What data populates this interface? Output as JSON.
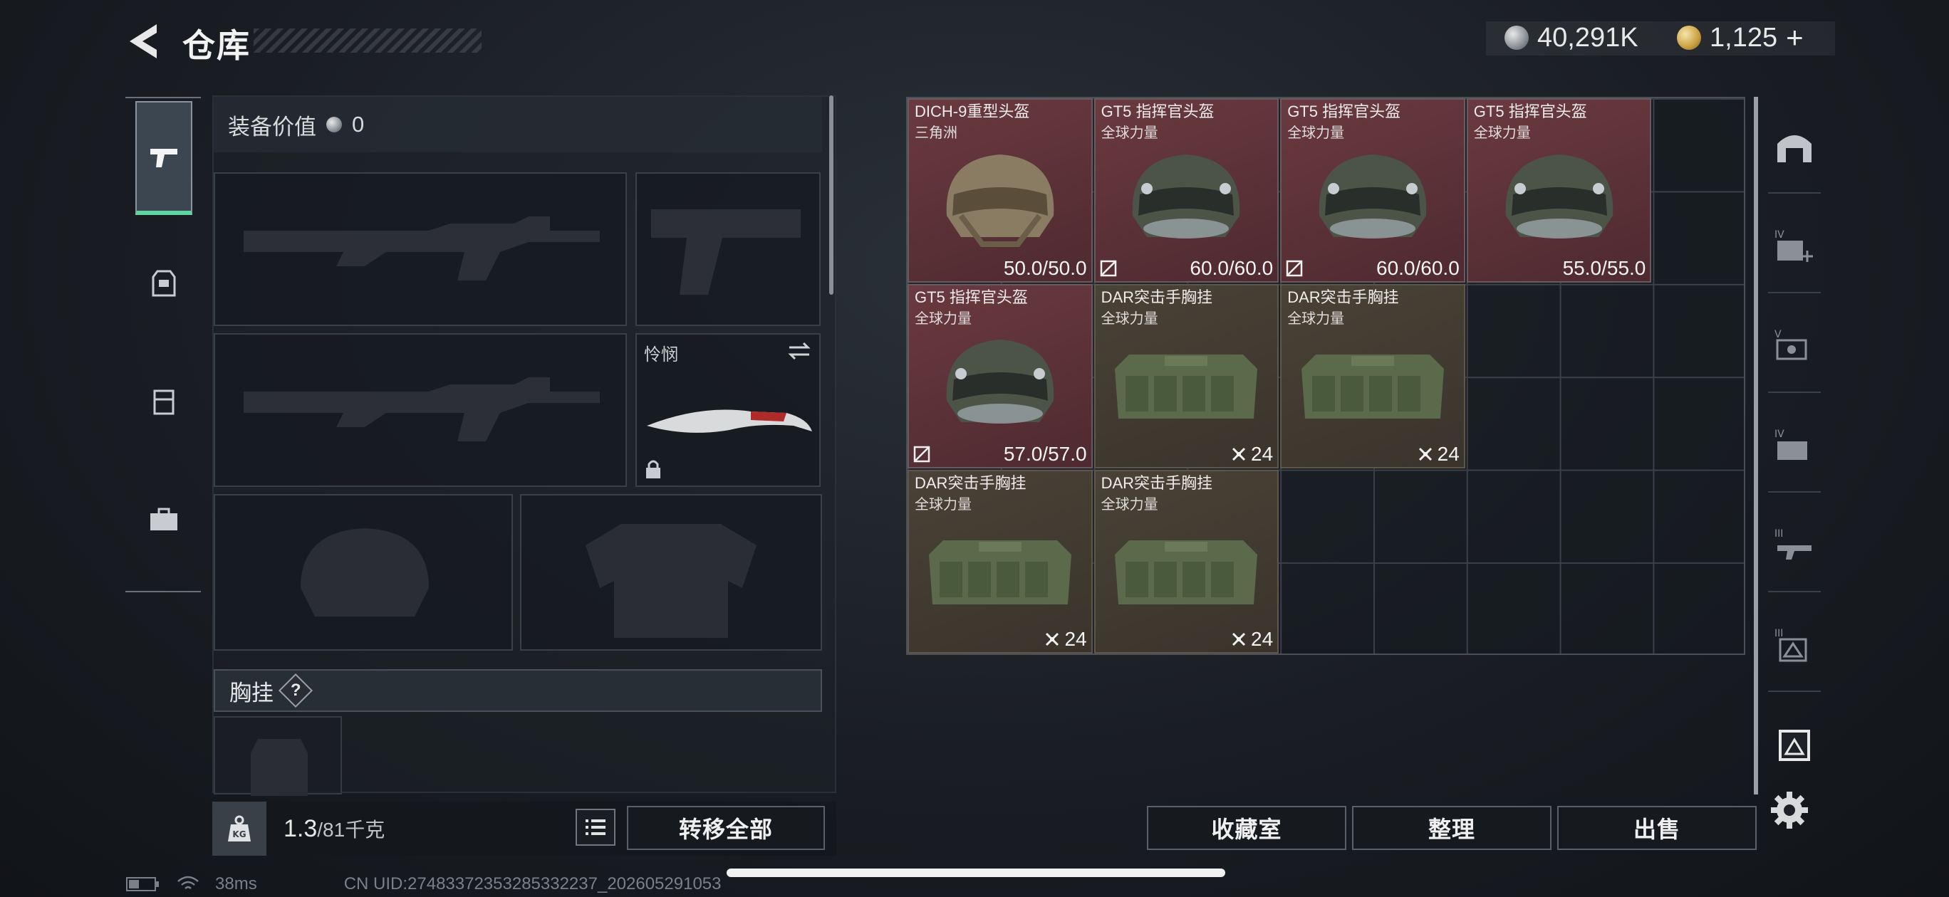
{
  "header": {
    "title": "仓库",
    "currency_a": "40,291K",
    "currency_b": "1,125",
    "add": "+"
  },
  "equipment": {
    "value_label": "装备价值",
    "value": "0",
    "melee_label": "怜悯",
    "chest_label": "胸挂",
    "help": "?",
    "weight_current": "1.3",
    "weight_max": "/81千克",
    "kg": "KG",
    "transfer_all": "转移全部"
  },
  "inventory": {
    "items": [
      {
        "name": "DICH-9重型头盔",
        "sub": "三角洲",
        "value": "50.0/50.0",
        "kind": "helmet-tan",
        "broken": false
      },
      {
        "name": "GT5 指挥官头盔",
        "sub": "全球力量",
        "value": "60.0/60.0",
        "kind": "helmet",
        "broken": true
      },
      {
        "name": "GT5 指挥官头盔",
        "sub": "全球力量",
        "value": "60.0/60.0",
        "kind": "helmet",
        "broken": true
      },
      {
        "name": "GT5 指挥官头盔",
        "sub": "全球力量",
        "value": "55.0/55.0",
        "kind": "helmet",
        "broken": false
      },
      {
        "name": "GT5 指挥官头盔",
        "sub": "全球力量",
        "value": "57.0/57.0",
        "kind": "helmet",
        "broken": true
      },
      {
        "name": "DAR突击手胸挂",
        "sub": "全球力量",
        "value": "24",
        "kind": "rig",
        "broken": false
      },
      {
        "name": "DAR突击手胸挂",
        "sub": "全球力量",
        "value": "24",
        "kind": "rig",
        "broken": false
      },
      {
        "name": "DAR突击手胸挂",
        "sub": "全球力量",
        "value": "24",
        "kind": "rig",
        "broken": false
      },
      {
        "name": "DAR突击手胸挂",
        "sub": "全球力量",
        "value": "24",
        "kind": "rig",
        "broken": false
      }
    ],
    "collection": "收藏室",
    "organize": "整理",
    "sell": "出售"
  },
  "status": {
    "ping": "38ms",
    "uid": "CN UID:27483372353285332237_202605291053"
  },
  "colors": {
    "accent": "#5ed6a0",
    "item_red": "#5c3238",
    "item_olive": "#433c32"
  }
}
